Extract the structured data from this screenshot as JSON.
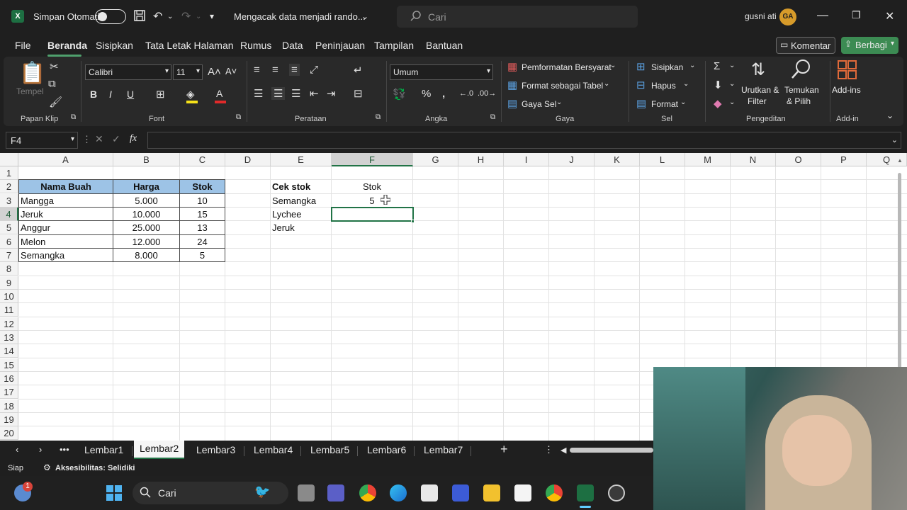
{
  "titlebar": {
    "autosave_label": "Simpan Otomatis",
    "document_title": "Mengacak data menjadi rando...",
    "search_placeholder": "Cari",
    "user_name": "gusni ati",
    "user_initials": "GA"
  },
  "menu": {
    "items": [
      "File",
      "Beranda",
      "Sisipkan",
      "Tata Letak Halaman",
      "Rumus",
      "Data",
      "Peninjauan",
      "Tampilan",
      "Bantuan"
    ],
    "active": "Beranda",
    "komentar_label": "Komentar",
    "berbagi_label": "Berbagi"
  },
  "ribbon": {
    "groups": {
      "clipboard": "Papan Klip",
      "font": "Font",
      "alignment": "Perataan",
      "number": "Angka",
      "styles": "Gaya",
      "cells": "Sel",
      "editing": "Pengeditan",
      "addins": "Add-in"
    },
    "paste_label": "Tempel",
    "font_name": "Calibri",
    "font_size": "11",
    "number_format": "Umum",
    "conditional_formatting": "Pemformatan Bersyarat",
    "format_as_table": "Format sebagai Tabel",
    "cell_styles": "Gaya Sel",
    "insert": "Sisipkan",
    "delete": "Hapus",
    "format": "Format",
    "sort_filter_1": "Urutkan &",
    "sort_filter_2": "Filter",
    "find_select_1": "Temukan",
    "find_select_2": "& Pilih",
    "addins_label": "Add-ins"
  },
  "formula_bar": {
    "name_box": "F4",
    "fx": "fx",
    "content": ""
  },
  "sheet": {
    "columns": [
      "A",
      "B",
      "C",
      "D",
      "E",
      "F",
      "G",
      "H",
      "I",
      "J",
      "K",
      "L",
      "M",
      "N",
      "O",
      "P",
      "Q"
    ],
    "rows": [
      "1",
      "2",
      "3",
      "4",
      "5",
      "6",
      "7",
      "8",
      "9",
      "10",
      "11",
      "12",
      "13",
      "14",
      "15",
      "16",
      "17",
      "18",
      "19",
      "20"
    ],
    "selected_cell": "F4",
    "table": {
      "headers": [
        "Nama Buah",
        "Harga",
        "Stok"
      ],
      "rows": [
        [
          "Mangga",
          "5.000",
          "10"
        ],
        [
          "Jeruk",
          "10.000",
          "15"
        ],
        [
          "Anggur",
          "25.000",
          "13"
        ],
        [
          "Melon",
          "12.000",
          "24"
        ],
        [
          "Semangka",
          "8.000",
          "5"
        ]
      ]
    },
    "lookup": {
      "label": "Cek stok",
      "header": "Stok",
      "rows": [
        [
          "Semangka",
          "5"
        ],
        [
          "Lychee",
          ""
        ],
        [
          "Jeruk",
          ""
        ]
      ]
    }
  },
  "sheet_tabs": [
    "Lembar1",
    "Lembar2",
    "Lembar3",
    "Lembar4",
    "Lembar5",
    "Lembar6",
    "Lembar7"
  ],
  "active_tab": "Lembar2",
  "status": {
    "ready": "Siap",
    "accessibility": "Aksesibilitas: Selidiki"
  },
  "taskbar": {
    "search_label": "Cari",
    "notification_count": "1"
  },
  "colors": {
    "accent": "#217346",
    "header_fill": "#9dc3e6",
    "share_button": "#3c8b53"
  }
}
